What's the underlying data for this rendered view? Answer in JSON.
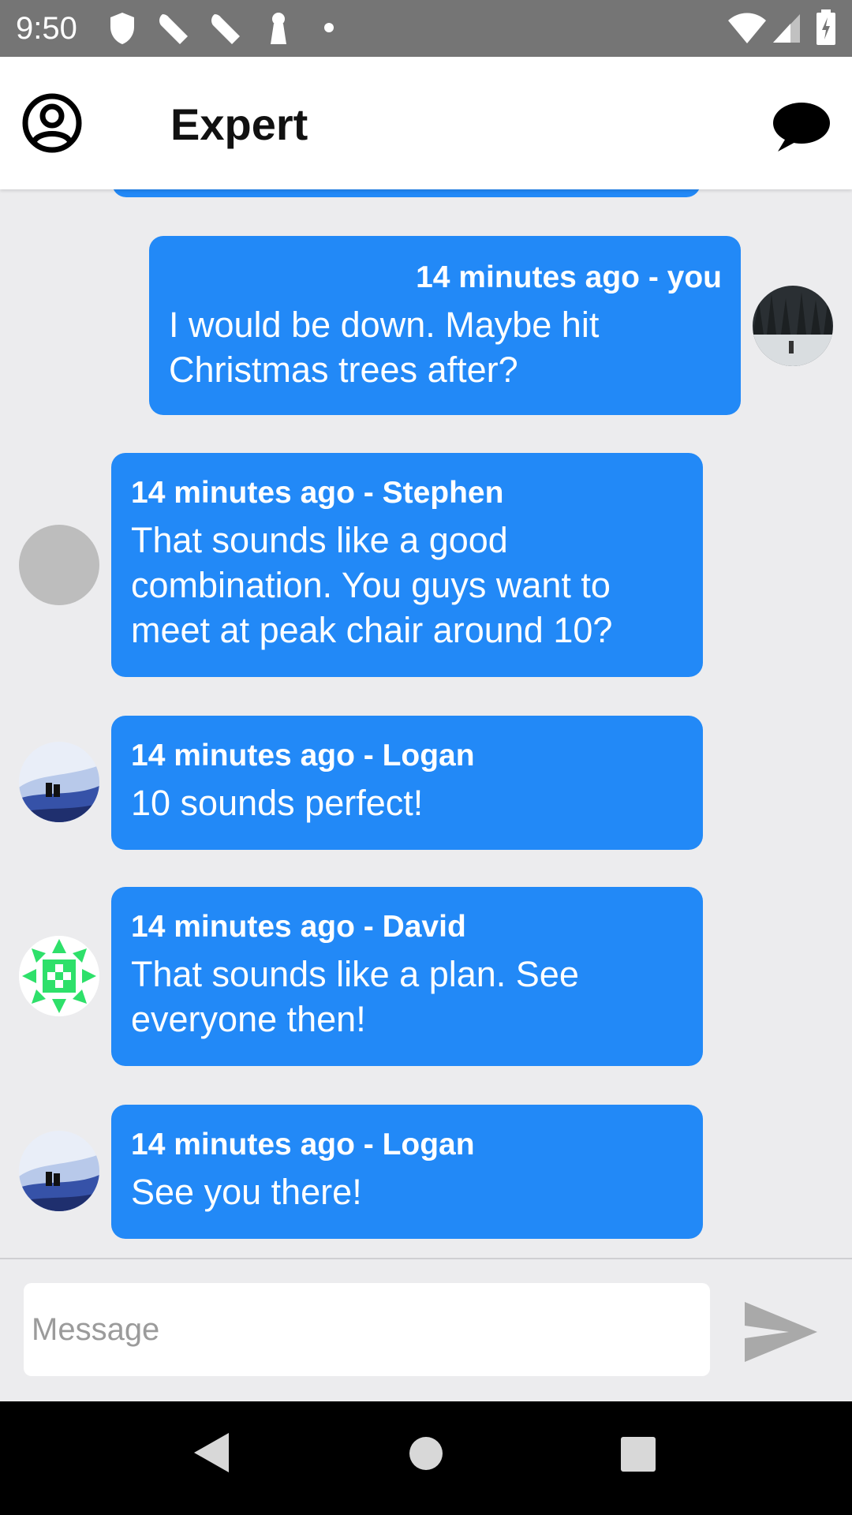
{
  "status_bar": {
    "time": "9:50",
    "icons": [
      "shield-icon",
      "wrench-icon",
      "wrench-icon",
      "keyhole-icon",
      "dot-icon",
      "wifi-icon",
      "signal-icon",
      "battery-charging-icon"
    ]
  },
  "app_bar": {
    "title": "Expert",
    "left_icon": "account-circle-icon",
    "right_icon": "chat-bubble-icon"
  },
  "messages": [
    {
      "meta": "14 minutes ago - you",
      "text": "I would be down.  Maybe hit Christmas trees after?",
      "sender": "you"
    },
    {
      "meta": "14 minutes ago - Stephen",
      "text": "That sounds like a good combination.  You guys want to meet at peak chair around 10?",
      "sender": "Stephen"
    },
    {
      "meta": "14 minutes ago - Logan",
      "text": "10 sounds perfect!",
      "sender": "Logan"
    },
    {
      "meta": "14 minutes ago - David",
      "text": "That sounds like a plan.  See everyone then!",
      "sender": "David"
    },
    {
      "meta": "14 minutes ago - Logan",
      "text": "See you there!",
      "sender": "Logan"
    }
  ],
  "composer": {
    "placeholder": "Message",
    "value": "",
    "send_icon": "send-icon"
  },
  "nav_bar": {
    "icons": [
      "back-icon",
      "home-icon",
      "recents-icon"
    ]
  },
  "colors": {
    "bubble": "#2289f7",
    "background": "#ececee",
    "status_bar": "#757575",
    "nav_bar": "#000000"
  }
}
